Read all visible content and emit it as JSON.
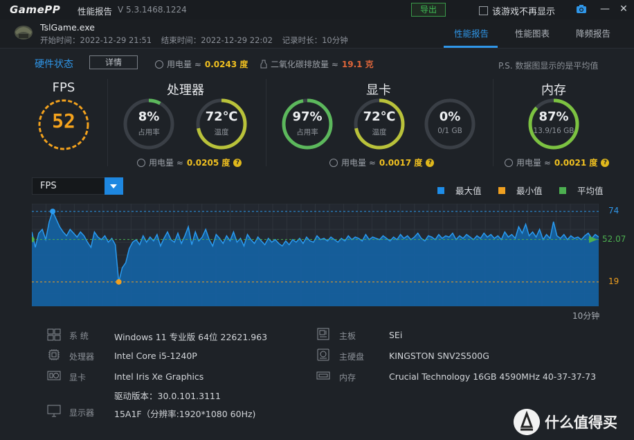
{
  "app": {
    "logo": "GamePP",
    "title": "性能报告",
    "version": "V 5.3.1468.1224",
    "export_label": "导出",
    "no_display_label": "该游戏不再显示"
  },
  "game": {
    "name": "TslGame.exe",
    "start": "开始时间：2022-12-29 21:51",
    "end": "结束时间：2022-12-29 22:02",
    "duration": "记录时长：10分钟"
  },
  "tabs": [
    {
      "label": "性能报告",
      "active": true
    },
    {
      "label": "性能图表",
      "active": false
    },
    {
      "label": "降频报告",
      "active": false
    }
  ],
  "hardware": {
    "title": "硬件状态",
    "detail_label": "详情",
    "power_label": "用电量 ≈",
    "power_value": "0.0243 度",
    "co2_label": "二氧化碳排放量 ≈",
    "co2_value": "19.1 克",
    "note": "P.S. 数据图显示的是平均值"
  },
  "sections": {
    "fps": {
      "title": "FPS",
      "value": "52"
    },
    "cpu": {
      "title": "处理器",
      "usage": {
        "value": "8%",
        "label": "占用率",
        "fraction": 0.08
      },
      "temp": {
        "value": "72℃",
        "label": "温度",
        "fraction": 0.72
      },
      "power_label": "用电量 ≈",
      "power_value": "0.0205 度"
    },
    "gpu": {
      "title": "显卡",
      "usage": {
        "value": "97%",
        "label": "占用率",
        "fraction": 0.97
      },
      "temp": {
        "value": "72℃",
        "label": "温度",
        "fraction": 0.72
      },
      "vram": {
        "value": "0%",
        "label": "0/1 GB",
        "fraction": 0.0
      },
      "power_label": "用电量 ≈",
      "power_value": "0.0017 度"
    },
    "mem": {
      "title": "内存",
      "usage": {
        "value": "87%",
        "label": "13.9/16 GB",
        "fraction": 0.87
      },
      "power_label": "用电量 ≈",
      "power_value": "0.0021 度"
    }
  },
  "chart_select": "FPS",
  "legend": [
    {
      "label": "最大值",
      "color": "#1e8de8"
    },
    {
      "label": "最小值",
      "color": "#f0a020"
    },
    {
      "label": "平均值",
      "color": "#4caf50"
    }
  ],
  "chart_data": {
    "type": "area",
    "title": "",
    "series": [
      {
        "name": "FPS",
        "color": "#1e8de8"
      }
    ],
    "duration_label": "10分钟",
    "max": 74,
    "min": 19,
    "avg": 52.07,
    "max_label": "74",
    "min_label": "19",
    "avg_label": "52.07",
    "ylim": [
      0,
      80
    ],
    "values": [
      58,
      46,
      57,
      60,
      52,
      66,
      74,
      68,
      62,
      58,
      55,
      60,
      57,
      54,
      58,
      55,
      50,
      46,
      58,
      54,
      52,
      55,
      50,
      53,
      48,
      19,
      30,
      34,
      45,
      50,
      52,
      48,
      55,
      50,
      54,
      51,
      56,
      47,
      53,
      58,
      52,
      50,
      57,
      49,
      55,
      62,
      48,
      58,
      51,
      54,
      60,
      52,
      47,
      56,
      53,
      49,
      55,
      51,
      58,
      50,
      53,
      47,
      56,
      52,
      49,
      54,
      51,
      48,
      53,
      50,
      52,
      49,
      47,
      51,
      48,
      52,
      50,
      53,
      49,
      54,
      51,
      50,
      55,
      52,
      53,
      51,
      54,
      52,
      50,
      53,
      51,
      55,
      52,
      54,
      53,
      51,
      56,
      52,
      54,
      53,
      52,
      55,
      53,
      51,
      54,
      52,
      56,
      53,
      55,
      52,
      54,
      57,
      53,
      51,
      55,
      54,
      52,
      56,
      53,
      55,
      54,
      57,
      52,
      55,
      53,
      56,
      54,
      52,
      55,
      53,
      57,
      54,
      56,
      53,
      55,
      52,
      58,
      54,
      56,
      53,
      62,
      57,
      64,
      55,
      58,
      54,
      60,
      52,
      56,
      53,
      66,
      55,
      53,
      56,
      52,
      55,
      53,
      54,
      52,
      55,
      57,
      53,
      56,
      54
    ]
  },
  "info": {
    "left": [
      {
        "icon": "windows-icon",
        "key": "系 统",
        "value": "Windows 11 专业版 64位 22621.963"
      },
      {
        "icon": "cpu-icon",
        "key": "处理器",
        "value": "Intel Core i5-1240P"
      },
      {
        "icon": "gpu-icon",
        "key": "显卡",
        "value": "Intel Iris Xe Graphics",
        "value2": "驱动版本：30.0.101.3111"
      },
      {
        "icon": "monitor-icon",
        "key": "显示器",
        "value": "15A1F（分辨率:1920*1080 60Hz)"
      }
    ],
    "right": [
      {
        "icon": "motherboard-icon",
        "key": "主板",
        "value": "SEi"
      },
      {
        "icon": "disk-icon",
        "key": "主硬盘",
        "value": "KINGSTON SNV2S500G"
      },
      {
        "icon": "memory-icon",
        "key": "内存",
        "value": "Crucial Technology 16GB 4590MHz 40-37-37-73"
      }
    ]
  },
  "watermark": {
    "text": "什么值得买"
  }
}
